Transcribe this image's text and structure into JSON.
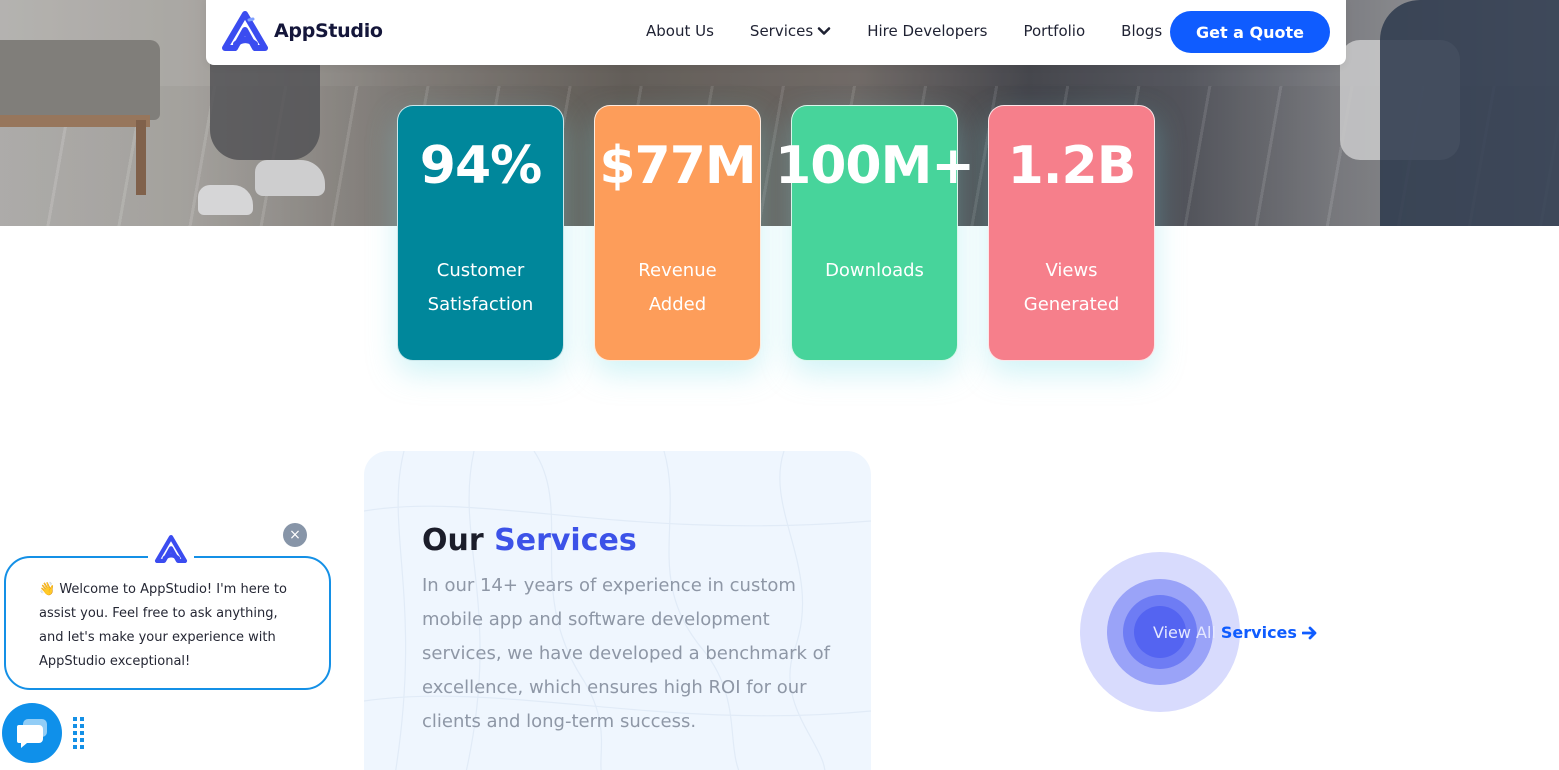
{
  "brand": {
    "name": "AppStudio",
    "color": "#0f5cff"
  },
  "nav": {
    "items": [
      {
        "label": "About Us",
        "has_dropdown": false
      },
      {
        "label": "Services",
        "has_dropdown": true
      },
      {
        "label": "Hire Developers",
        "has_dropdown": false
      },
      {
        "label": "Portfolio",
        "has_dropdown": false
      },
      {
        "label": "Blogs",
        "has_dropdown": false
      }
    ],
    "cta_label": "Get a Quote"
  },
  "stats": [
    {
      "value": "94%",
      "label": "Customer Satisfaction",
      "color": "#00879b"
    },
    {
      "value": "$77M",
      "label": "Revenue Added",
      "color": "#fd9d5a"
    },
    {
      "value": "100M+",
      "label": "Downloads",
      "color": "#47d49b"
    },
    {
      "value": "1.2B",
      "label": "Views Generated",
      "color": "#f67f8b"
    }
  ],
  "services": {
    "title_plain": "Our",
    "title_accent": "Services",
    "description": "In our 14+ years of experience in custom mobile app and software development services, we have developed a benchmark of excellence, which ensures high ROI for our clients and long-term success.",
    "view_all_pre": "View All",
    "view_all_post": "Services"
  },
  "chat": {
    "emoji": "👋",
    "message": "Welcome to AppStudio! I'm here to assist you. Feel free to ask anything, and let's make your experience with AppStudio exceptional!",
    "close_symbol": "×",
    "icons": {
      "launcher": "chat-icon",
      "close": "close-icon",
      "handle": "drag-handle-icon"
    }
  }
}
